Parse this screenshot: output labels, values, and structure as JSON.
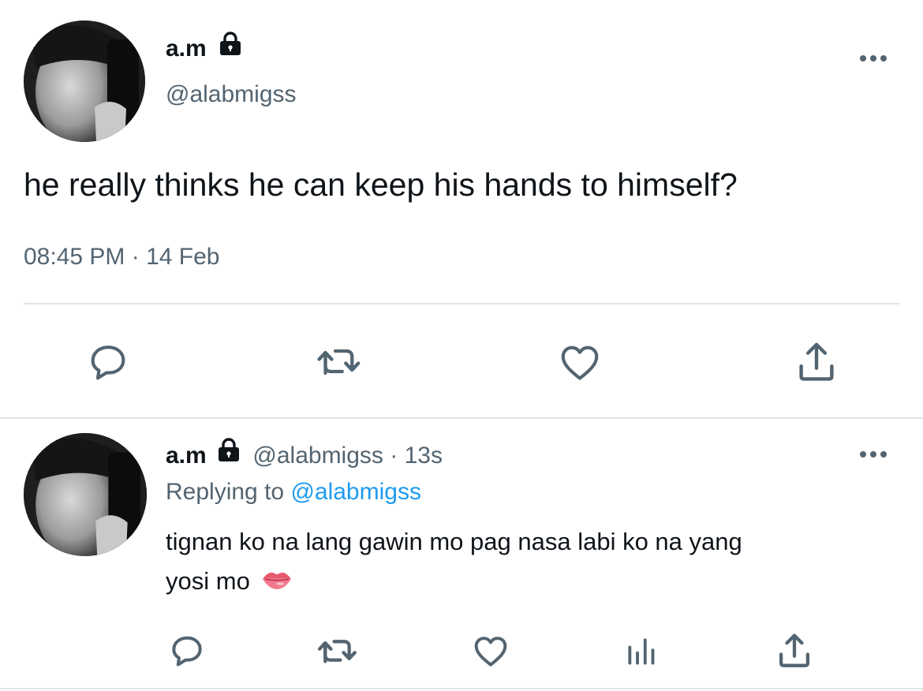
{
  "main_tweet": {
    "display_name": "a.m",
    "handle": "@alabmigss",
    "text": "he really thinks he can keep his hands to himself?",
    "timestamp": "08:45 PM · 14 Feb",
    "actions": [
      "reply-icon",
      "retweet-icon",
      "like-icon",
      "share-icon"
    ]
  },
  "reply_tweet": {
    "display_name": "a.m",
    "handle": "@alabmigss",
    "time_ago": "· 13s",
    "replying_label": "Replying to",
    "replying_handle": "@alabmigss",
    "text_line1": "tignan ko na lang gawin mo pag nasa labi ko na yang",
    "text_line2": "yosi mo",
    "emoji": "👄",
    "actions": [
      "reply-icon",
      "retweet-icon",
      "like-icon",
      "analytics-icon",
      "share-icon"
    ]
  },
  "colors": {
    "text": "#0f1419",
    "secondary": "#536471",
    "link": "#1d9bf0",
    "divider": "#e1e4e8"
  }
}
